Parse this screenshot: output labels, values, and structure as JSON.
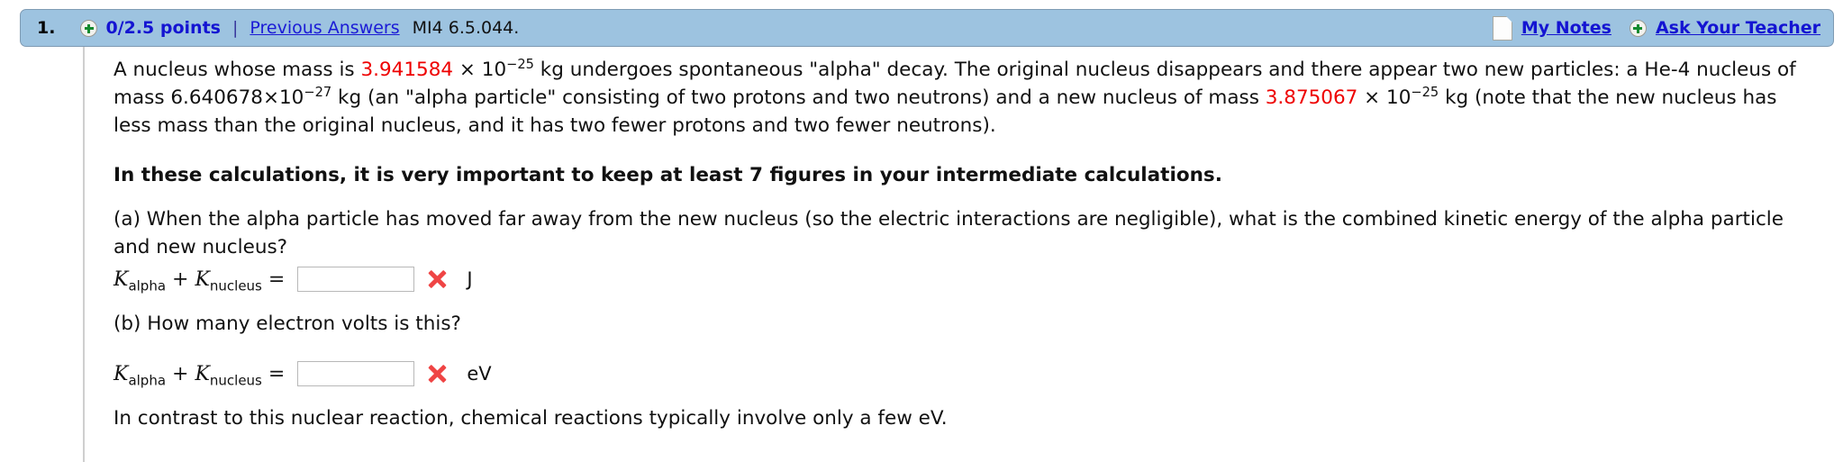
{
  "header": {
    "question_number": "1.",
    "points": "0/2.5 points",
    "separator": "|",
    "previous_answers": "Previous Answers",
    "question_code": "MI4 6.5.044.",
    "my_notes": "My Notes",
    "ask_your_teacher": "Ask Your Teacher",
    "bar_color": "#9dc3e0",
    "link_color": "#1414d2",
    "plus_icon": "plus-circle-icon",
    "note_icon": "note-page-icon"
  },
  "body": {
    "intro": {
      "t1": "A nucleus whose mass is ",
      "mass_original": "3.941584",
      "t2": " × 10",
      "exp_original": "−25",
      "t3": " kg undergoes spontaneous \"alpha\" decay. The original nucleus disappears and there appear two new particles: a He-4 nucleus of mass 6.640678×10",
      "exp_alpha": "−27",
      "t4": " kg (an \"alpha particle\" consisting of two protons and two neutrons) and a new nucleus of mass ",
      "mass_new": "3.875067",
      "t5": " × 10",
      "exp_new": "−25",
      "t6": " kg (note that the new nucleus has less mass than the original nucleus, and it has two fewer protons and two fewer neutrons)."
    },
    "emphasis": "In these calculations, it is very important to keep at least 7 figures in your intermediate calculations.",
    "part_a": {
      "prompt": "(a) When the alpha particle has moved far away from the new nucleus (so the electric interactions are negligible), what is the combined kinetic energy of the alpha particle and new nucleus?",
      "k_symbol": "K",
      "sub_alpha": "alpha",
      "plus": " + ",
      "sub_nucleus": "nucleus",
      "equals": " = ",
      "input_value": "",
      "input_placeholder": "",
      "mark": "incorrect-x-icon",
      "unit": "J"
    },
    "part_b": {
      "prompt": "(b) How many electron volts is this?",
      "k_symbol": "K",
      "sub_alpha": "alpha",
      "plus": " + ",
      "sub_nucleus": "nucleus",
      "equals": " = ",
      "input_value": "",
      "input_placeholder": "",
      "mark": "incorrect-x-icon",
      "unit": "eV"
    },
    "closing": "In contrast to this nuclear reaction, chemical reactions typically involve only a few eV."
  },
  "colors": {
    "red_value": "#ee0000",
    "link_blue": "#1414d2",
    "bar_blue": "#9dc3e0",
    "mark_red": "#ef4444"
  }
}
